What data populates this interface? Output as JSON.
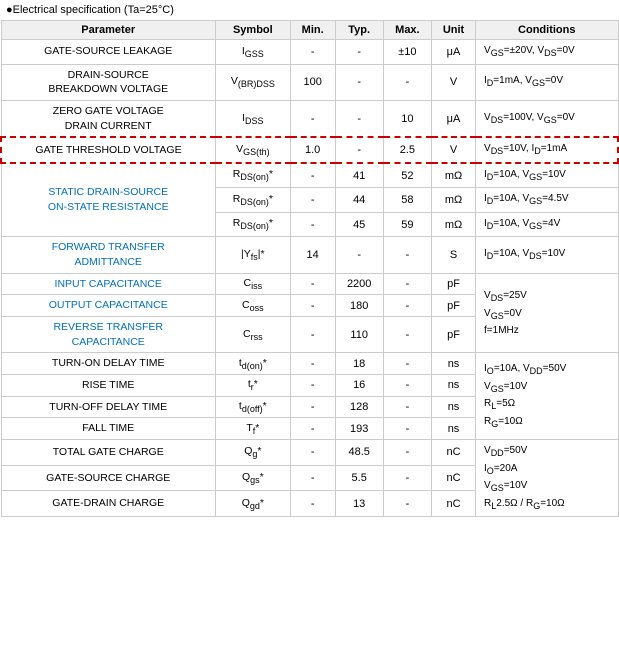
{
  "title": "Electrical specification (Ta=25°C)",
  "columns": [
    "Parameter",
    "Symbol",
    "Min.",
    "Typ.",
    "Max.",
    "Unit",
    "Conditions"
  ],
  "rows": [
    {
      "id": "gate-source-leakage",
      "param": "GATE-SOURCE LEAKAGE",
      "param_color": "black",
      "symbol": "IGSS",
      "min": "-",
      "typ": "-",
      "max": "±10",
      "unit": "μA",
      "conditions": "VGS=±20V, VDS=0V",
      "rowspan": 1,
      "highlight": false
    },
    {
      "id": "drain-source-breakdown",
      "param": "DRAIN-SOURCE\nBREAKDOWN VOLTAGE",
      "param_color": "black",
      "symbol": "V(BR)DSS",
      "min": "100",
      "typ": "-",
      "max": "-",
      "unit": "V",
      "conditions": "ID=1mA, VGS=0V",
      "rowspan": 1,
      "highlight": false
    },
    {
      "id": "zero-gate-voltage",
      "param": "ZERO GATE VOLTAGE\nDRAIN CURRENT",
      "param_color": "black",
      "symbol": "IDSS",
      "min": "-",
      "typ": "-",
      "max": "10",
      "unit": "μA",
      "conditions": "VDS=100V, VGS=0V",
      "rowspan": 1,
      "highlight": false
    },
    {
      "id": "gate-threshold-voltage",
      "param": "GATE THRESHOLD VOLTAGE",
      "param_color": "black",
      "symbol": "VGS(th)",
      "min": "1.0",
      "typ": "-",
      "max": "2.5",
      "unit": "V",
      "conditions": "VDS=10V, ID=1mA",
      "rowspan": 1,
      "highlight": true
    },
    {
      "id": "static-drain-source-1",
      "param": "STATIC DRAIN-SOURCE\nON-STATE RESISTANCE",
      "param_color": "blue",
      "symbol": "RDS(on)*",
      "min": "-",
      "typ": "41",
      "max": "52",
      "unit": "mΩ",
      "conditions": "ID=10A, VGS=10V",
      "rowspan": 3,
      "is_first_of_group": true
    },
    {
      "id": "static-drain-source-2",
      "param": "",
      "param_color": "blue",
      "symbol": "RDS(on)*",
      "min": "-",
      "typ": "44",
      "max": "58",
      "unit": "mΩ",
      "conditions": "ID=10A, VGS=4.5V",
      "rowspan": 0,
      "is_continuation": true
    },
    {
      "id": "static-drain-source-3",
      "param": "",
      "param_color": "blue",
      "symbol": "RDS(on)*",
      "min": "-",
      "typ": "45",
      "max": "59",
      "unit": "mΩ",
      "conditions": "ID=10A, VGS=4V",
      "rowspan": 0,
      "is_continuation": true
    },
    {
      "id": "forward-transfer-admittance",
      "param": "FORWARD TRANSFER\nADMITTANCE",
      "param_color": "blue",
      "symbol": "|Yfs|*",
      "min": "14",
      "typ": "-",
      "max": "-",
      "unit": "S",
      "conditions": "ID=10A, VDS=10V",
      "rowspan": 1,
      "highlight": false
    },
    {
      "id": "input-capacitance",
      "param": "INPUT CAPACITANCE",
      "param_color": "blue",
      "symbol": "Ciss",
      "min": "-",
      "typ": "2200",
      "max": "-",
      "unit": "pF",
      "conditions": "",
      "rowspan": 3,
      "is_first_of_cap_group": true
    },
    {
      "id": "output-capacitance",
      "param": "OUTPUT CAPACITANCE",
      "param_color": "blue",
      "symbol": "Coss",
      "min": "-",
      "typ": "180",
      "max": "-",
      "unit": "pF",
      "conditions": "",
      "rowspan": 0,
      "is_cap_continuation": true
    },
    {
      "id": "reverse-transfer-capacitance",
      "param": "REVERSE TRANSFER\nCAPACITANCE",
      "param_color": "blue",
      "symbol": "Crss",
      "min": "-",
      "typ": "110",
      "max": "-",
      "unit": "pF",
      "conditions": "",
      "rowspan": 0,
      "is_cap_continuation": true
    },
    {
      "id": "turn-on-delay-time",
      "param": "TURN-ON DELAY TIME",
      "param_color": "black",
      "symbol": "td(on)*",
      "min": "-",
      "typ": "18",
      "max": "-",
      "unit": "ns",
      "conditions": "",
      "rowspan": 4,
      "is_first_of_switch_group": true
    },
    {
      "id": "rise-time",
      "param": "RISE TIME",
      "param_color": "black",
      "symbol": "tr*",
      "min": "-",
      "typ": "16",
      "max": "-",
      "unit": "ns",
      "conditions": "",
      "rowspan": 0,
      "is_switch_continuation": true
    },
    {
      "id": "turn-off-delay-time",
      "param": "TURN-OFF DELAY TIME",
      "param_color": "black",
      "symbol": "td(off)*",
      "min": "-",
      "typ": "128",
      "max": "-",
      "unit": "ns",
      "conditions": "",
      "rowspan": 0,
      "is_switch_continuation": true
    },
    {
      "id": "fall-time",
      "param": "FALL TIME",
      "param_color": "black",
      "symbol": "Tf*",
      "min": "-",
      "typ": "193",
      "max": "-",
      "unit": "ns",
      "conditions": "",
      "rowspan": 0,
      "is_switch_continuation": true
    },
    {
      "id": "total-gate-charge",
      "param": "TOTAL GATE CHARGE",
      "param_color": "black",
      "symbol": "Qg*",
      "min": "-",
      "typ": "48.5",
      "max": "-",
      "unit": "nC",
      "conditions": "",
      "rowspan": 3,
      "is_first_of_charge_group": true
    },
    {
      "id": "gate-source-charge",
      "param": "GATE-SOURCE CHARGE",
      "param_color": "black",
      "symbol": "Qgs*",
      "min": "-",
      "typ": "5.5",
      "max": "-",
      "unit": "nC",
      "conditions": "",
      "rowspan": 0,
      "is_charge_continuation": true
    },
    {
      "id": "gate-drain-charge",
      "param": "GATE-DRAIN CHARGE",
      "param_color": "black",
      "symbol": "Qgd*",
      "min": "-",
      "typ": "13",
      "max": "-",
      "unit": "nC",
      "conditions": "",
      "rowspan": 0,
      "is_charge_continuation": true
    }
  ],
  "cap_conditions": "VDS=25V\nVGS=0V\nf=1MHz",
  "switch_conditions": "IO=10A, VDD=50V\nVGS=10V\nRL=5Ω\nRG=10Ω",
  "charge_conditions": "VDD=50V\nIO=20A\nVGS=10V\nRL2.5Ω / RG=10Ω"
}
